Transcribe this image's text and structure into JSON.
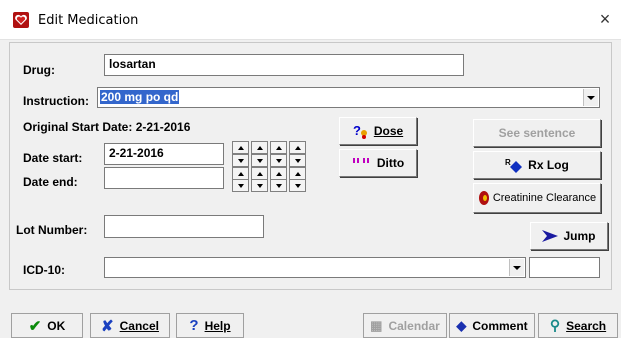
{
  "window": {
    "title": "Edit Medication",
    "close_glyph": "×"
  },
  "drug": {
    "label": "Drug:",
    "value": "losartan"
  },
  "instruction": {
    "label": "Instruction:",
    "value": "200 mg po qd"
  },
  "original_start": {
    "text": "Original Start Date: 2-21-2016"
  },
  "date_start": {
    "label": "Date start:",
    "value": "2-21-2016"
  },
  "date_end": {
    "label": "Date end:",
    "value": ""
  },
  "buttons": {
    "dose": "Dose",
    "ditto": "Ditto",
    "see_sentence": "See sentence",
    "rx_log": "Rx Log",
    "creatinine": "Creatinine Clearance",
    "jump": "Jump"
  },
  "lot_number": {
    "label": "Lot Number:",
    "value": ""
  },
  "icd10": {
    "label": "ICD-10:",
    "value": "",
    "code": ""
  },
  "bottom": {
    "ok": "OK",
    "cancel": "Cancel",
    "help": "Help",
    "calendar": "Calendar",
    "comment": "Comment",
    "search": "Search"
  },
  "colors": {
    "selection": "#3366cc",
    "disabled_text": "#a0a0a0"
  }
}
